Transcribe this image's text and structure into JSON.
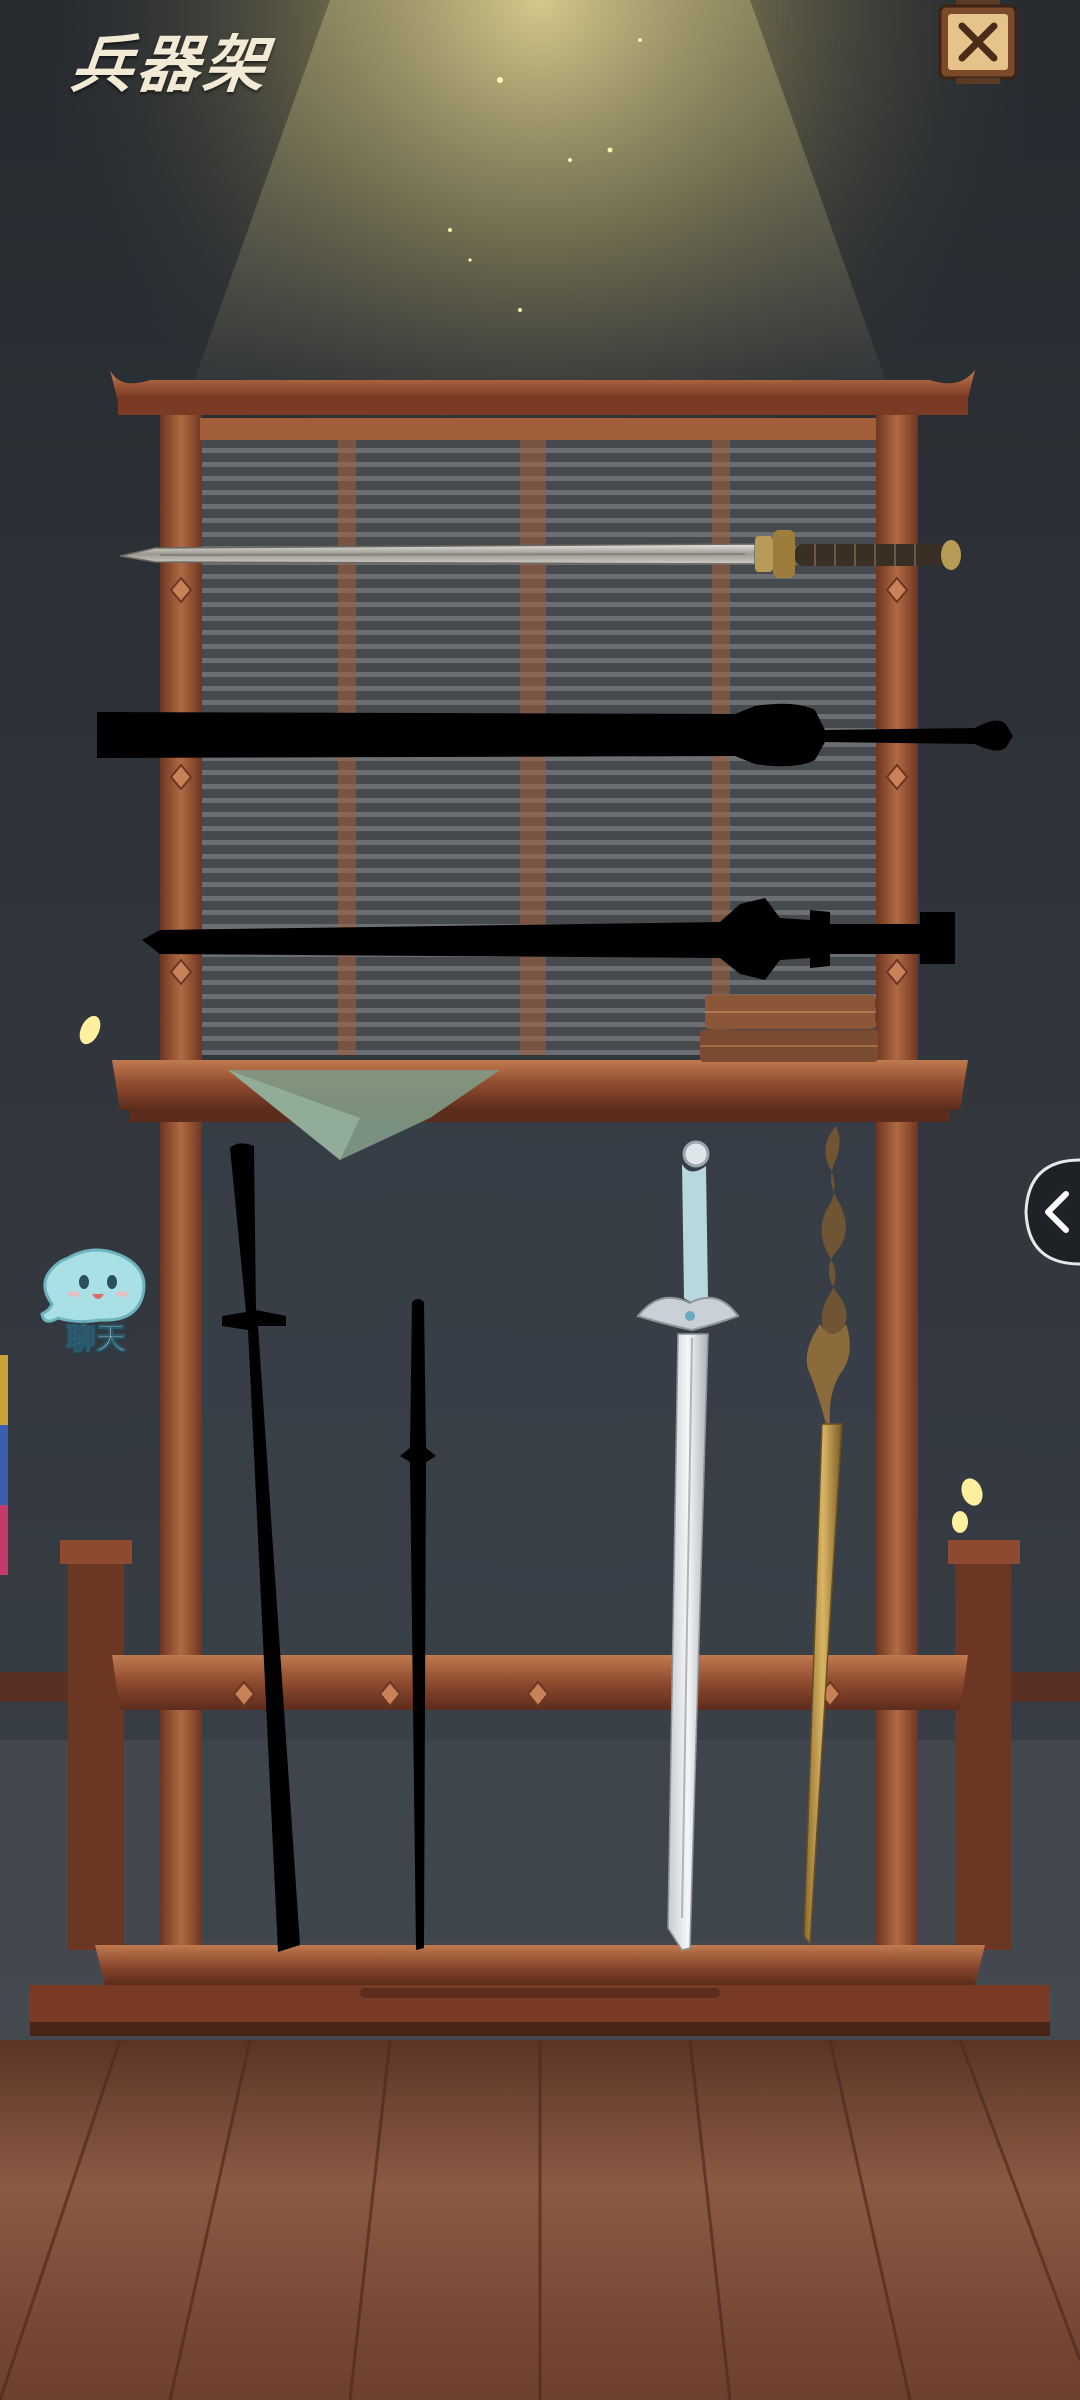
{
  "screen": {
    "title": "兵器架",
    "close_icon": "close-x-icon",
    "expand_icon": "chevron-left-icon"
  },
  "chat": {
    "label": "聊天",
    "icon": "chat-bubble-face-icon"
  },
  "rack": {
    "horizontal_weapons": [
      {
        "id": "sword-1",
        "state": "unlocked"
      },
      {
        "id": "sword-2",
        "state": "silhouette"
      },
      {
        "id": "sword-3",
        "state": "silhouette"
      }
    ],
    "vertical_weapons": [
      {
        "id": "sword-4",
        "state": "silhouette"
      },
      {
        "id": "sword-5",
        "state": "silhouette"
      },
      {
        "id": "sword-6",
        "state": "unlocked"
      },
      {
        "id": "sword-7",
        "state": "unlocked"
      }
    ]
  },
  "colors": {
    "wood": "#8a4a2c",
    "wood_light": "#b8704a",
    "night_sky": "#1f2329",
    "spotlight": "#d9cf94",
    "floor": "#7a4b34"
  }
}
